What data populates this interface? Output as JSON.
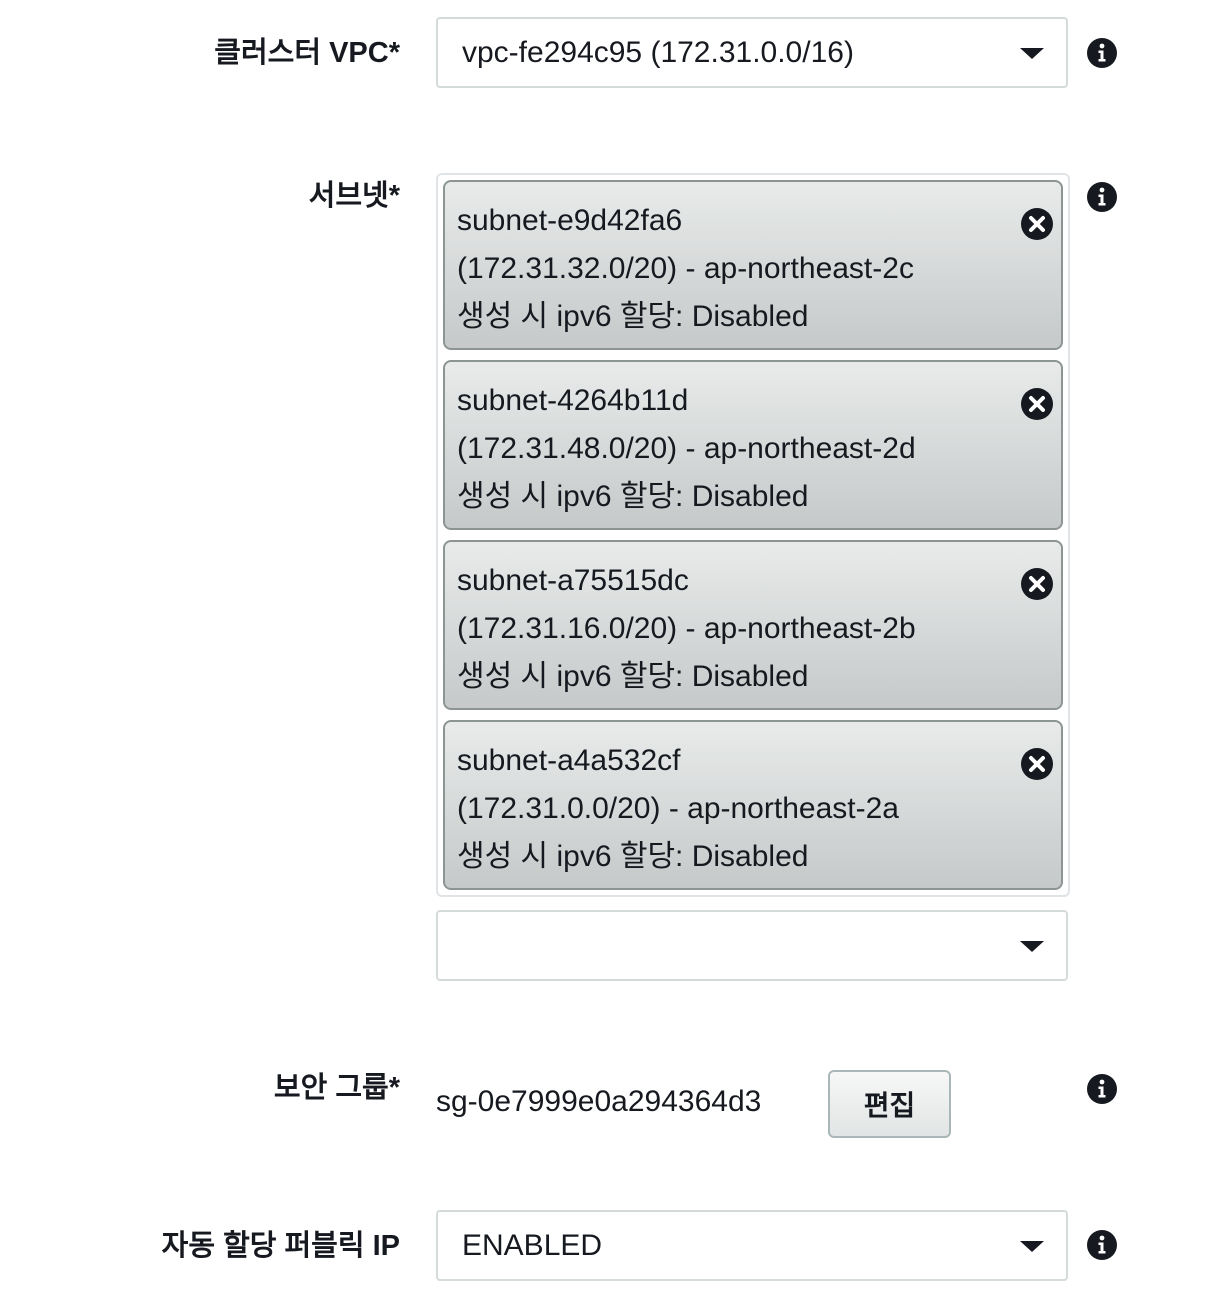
{
  "cluster_vpc": {
    "label": "클러스터 VPC*",
    "value": "vpc-fe294c95 (172.31.0.0/16)"
  },
  "subnets": {
    "label": "서브넷*",
    "items": [
      {
        "id": "subnet-e9d42fa6",
        "cidr_zone": "(172.31.32.0/20) - ap-northeast-2c",
        "ipv6": "생성 시 ipv6 할당: Disabled"
      },
      {
        "id": "subnet-4264b11d",
        "cidr_zone": "(172.31.48.0/20) - ap-northeast-2d",
        "ipv6": "생성 시 ipv6 할당: Disabled"
      },
      {
        "id": "subnet-a75515dc",
        "cidr_zone": "(172.31.16.0/20) - ap-northeast-2b",
        "ipv6": "생성 시 ipv6 할당: Disabled"
      },
      {
        "id": "subnet-a4a532cf",
        "cidr_zone": "(172.31.0.0/20) - ap-northeast-2a",
        "ipv6": "생성 시 ipv6 할당: Disabled"
      }
    ],
    "add_select_value": ""
  },
  "security_group": {
    "label": "보안 그룹*",
    "value": "sg-0e7999e0a294364d3",
    "edit_label": "편집"
  },
  "auto_public_ip": {
    "label": "자동 할당 퍼블릭 IP",
    "value": "ENABLED"
  },
  "icons": {
    "info": "info-icon",
    "remove": "close-circle-icon",
    "dropdown": "caret-down-icon"
  },
  "colors": {
    "text": "#16191f",
    "border": "#d5dbdb",
    "token_bg_top": "#e9ebeb",
    "token_bg_bottom": "#c6c9c9",
    "token_border": "#8d9494"
  }
}
